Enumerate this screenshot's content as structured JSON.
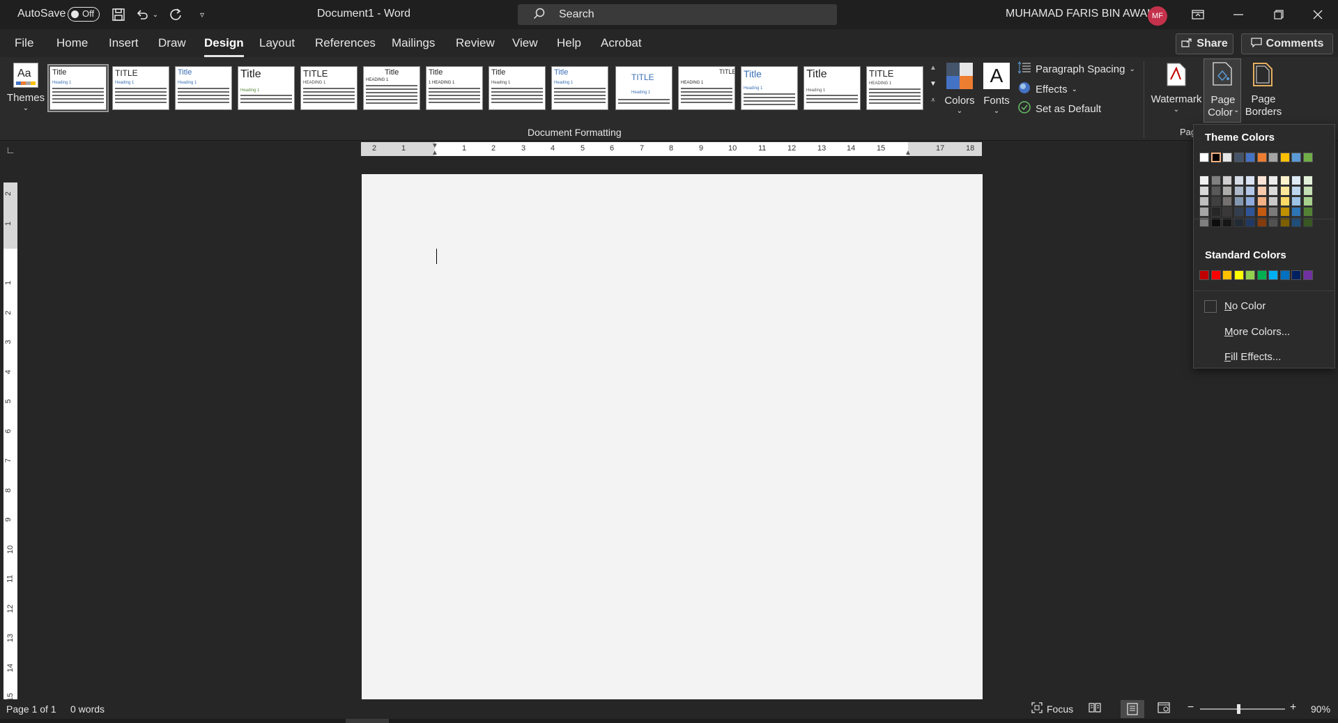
{
  "titlebar": {
    "autosave_label": "AutoSave",
    "autosave_state": "Off",
    "document_title": "Document1  -  Word",
    "search_placeholder": "Search",
    "user_name": "MUHAMAD FARIS BIN AWAL",
    "user_initials": "MF"
  },
  "menu": {
    "tabs": [
      "File",
      "Home",
      "Insert",
      "Draw",
      "Design",
      "Layout",
      "References",
      "Mailings",
      "Review",
      "View",
      "Help",
      "Acrobat"
    ],
    "active_tab": "Design",
    "share_label": "Share",
    "comments_label": "Comments"
  },
  "ribbon": {
    "themes_label": "Themes",
    "gallery_titles": [
      "Title",
      "TITLE",
      "Title",
      "Title",
      "TITLE",
      "Title",
      "Title",
      "Title",
      "Title",
      "TITLE",
      "TITLE",
      "Title",
      "Title",
      "TITLE"
    ],
    "gallery_headings": [
      "Heading 1",
      "Heading 1",
      "Heading 1",
      "Heading 1",
      "HEADING 1",
      "HEADING 1",
      "1  HEADING 1",
      "Heading 1",
      "Heading 1",
      "Heading 1",
      "HEADING 1",
      "Heading 1",
      "Heading 1",
      "HEADING 1"
    ],
    "colors_label": "Colors",
    "fonts_label": "Fonts",
    "paragraph_spacing_label": "Paragraph Spacing",
    "effects_label": "Effects",
    "set_default_label": "Set as Default",
    "document_formatting_label": "Document Formatting",
    "watermark_label": "Watermark",
    "page_color_label_1": "Page",
    "page_color_label_2": "Color",
    "page_borders_label_1": "Page",
    "page_borders_label_2": "Borders",
    "page_bg_group_label": "Pag"
  },
  "ruler": {
    "horizontal_ticks": [
      "2",
      "1",
      "1",
      "2",
      "3",
      "4",
      "5",
      "6",
      "7",
      "8",
      "9",
      "10",
      "11",
      "12",
      "13",
      "14",
      "15",
      "17",
      "18"
    ],
    "vertical_ticks": [
      "2",
      "1",
      "1",
      "2",
      "3",
      "4",
      "5",
      "6",
      "7",
      "8",
      "9",
      "10",
      "11",
      "12",
      "13",
      "14",
      "15"
    ]
  },
  "statusbar": {
    "page_info": "Page 1 of 1",
    "word_count": "0 words",
    "focus_label": "Focus",
    "zoom_level": "90%",
    "zoom_fraction": 0.45
  },
  "page_color_menu": {
    "theme_colors_heading": "Theme Colors",
    "standard_colors_heading": "Standard Colors",
    "no_color_label": "No Color",
    "no_color_mnemonic": "N",
    "more_colors_label": "More Colors...",
    "more_colors_mnemonic": "M",
    "fill_effects_label": "Fill Effects...",
    "fill_effects_mnemonic": "F",
    "theme_base_colors": [
      "#ffffff",
      "#000000",
      "#e7e6e6",
      "#44546a",
      "#4472c4",
      "#ed7d31",
      "#a5a5a5",
      "#ffc000",
      "#5b9bd5",
      "#70ad47"
    ],
    "theme_shades": [
      [
        "#f2f2f2",
        "#d9d9d9",
        "#bfbfbf",
        "#a6a6a6",
        "#808080"
      ],
      [
        "#808080",
        "#595959",
        "#404040",
        "#262626",
        "#0d0d0d"
      ],
      [
        "#d0cece",
        "#aeabab",
        "#757070",
        "#3a3838",
        "#161616"
      ],
      [
        "#d6dce5",
        "#adb9ca",
        "#8497b0",
        "#333f50",
        "#222a35"
      ],
      [
        "#dae3f3",
        "#b4c7e7",
        "#8faadc",
        "#2f5597",
        "#203864"
      ],
      [
        "#fbe5d6",
        "#f8cbad",
        "#f4b183",
        "#c55a11",
        "#843c0c"
      ],
      [
        "#ededed",
        "#dbdbdb",
        "#c9c9c9",
        "#7b7b7b",
        "#525252"
      ],
      [
        "#fff2cc",
        "#ffe699",
        "#ffd966",
        "#bf9000",
        "#7f6000"
      ],
      [
        "#deebf7",
        "#bdd7ee",
        "#9dc3e6",
        "#2e75b6",
        "#1f4e79"
      ],
      [
        "#e2f0d9",
        "#c5e0b4",
        "#a9d18e",
        "#548235",
        "#385723"
      ]
    ],
    "standard_colors": [
      "#c00000",
      "#ff0000",
      "#ffc000",
      "#ffff00",
      "#92d050",
      "#00b050",
      "#00b0f0",
      "#0070c0",
      "#002060",
      "#7030a0"
    ]
  }
}
